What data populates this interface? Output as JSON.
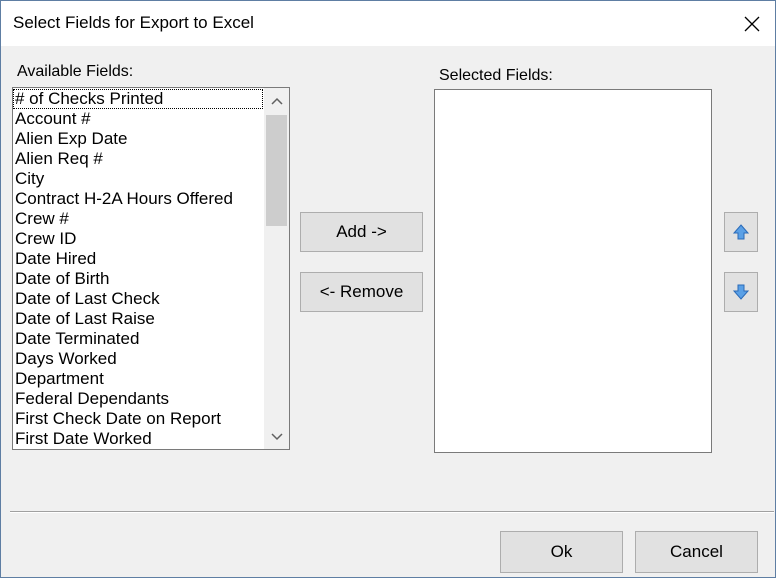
{
  "window": {
    "title": "Select Fields for Export to Excel",
    "close_icon": "close-icon"
  },
  "available": {
    "label": "Available Fields:",
    "items": [
      "# of Checks Printed",
      "Account #",
      "Alien Exp Date",
      "Alien Req #",
      "City",
      "Contract H-2A Hours Offered",
      "Crew #",
      "Crew ID",
      "Date Hired",
      "Date of Birth",
      "Date of Last Check",
      "Date of Last Raise",
      "Date Terminated",
      "Days Worked",
      "Department",
      "Federal Dependants",
      "First Check Date on Report",
      "First Date Worked"
    ]
  },
  "selected": {
    "label": "Selected Fields:",
    "items": []
  },
  "buttons": {
    "add": "Add ->",
    "remove": "<- Remove",
    "move_up_icon": "arrow-up-icon",
    "move_down_icon": "arrow-down-icon",
    "ok": "Ok",
    "cancel": "Cancel"
  },
  "colors": {
    "arrow_blue": "#4a8fd8",
    "button_face": "#e1e1e1",
    "dialog_bg": "#f0f0f0"
  }
}
